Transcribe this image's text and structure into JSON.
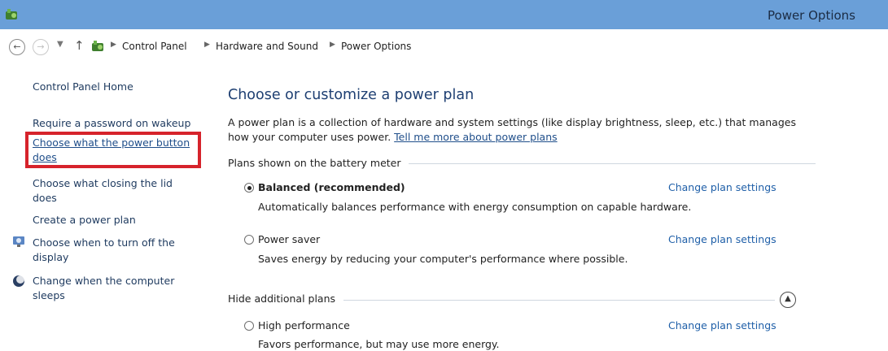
{
  "window": {
    "title": "Power Options",
    "icon": "power-options-icon"
  },
  "nav": {
    "back_icon": "back-arrow-icon",
    "forward_icon": "forward-arrow-icon",
    "recent_icon": "chevron-down-icon",
    "up_icon": "up-arrow-icon",
    "breadcrumb": [
      "Control Panel",
      "Hardware and Sound",
      "Power Options"
    ]
  },
  "sidebar": {
    "home": "Control Panel Home",
    "links": [
      "Require a password on wakeup",
      "Choose what the power button does",
      "Choose what closing the lid does",
      "Create a power plan",
      "Choose when to turn off the display",
      "Change when the computer sleeps"
    ]
  },
  "main": {
    "heading": "Choose or customize a power plan",
    "description": "A power plan is a collection of hardware and system settings (like display brightness, sleep, etc.) that manages how your computer uses power.",
    "description_link": "Tell me more about power plans",
    "battery_section": "Plans shown on the battery meter",
    "additional_section": "Hide additional plans",
    "plans": [
      {
        "name": "Balanced (recommended)",
        "description": "Automatically balances performance with energy consumption on capable hardware.",
        "selected": true,
        "link": "Change plan settings"
      },
      {
        "name": "Power saver",
        "description": "Saves energy by reducing your computer's performance where possible.",
        "selected": false,
        "link": "Change plan settings"
      },
      {
        "name": "High performance",
        "description": "Favors performance, but may use more energy.",
        "selected": false,
        "link": "Change plan settings"
      }
    ]
  },
  "colors": {
    "titlebar": "#6a9fd8",
    "link": "#1f5fa8",
    "heading": "#1e3f72",
    "highlight": "#d6232b"
  }
}
